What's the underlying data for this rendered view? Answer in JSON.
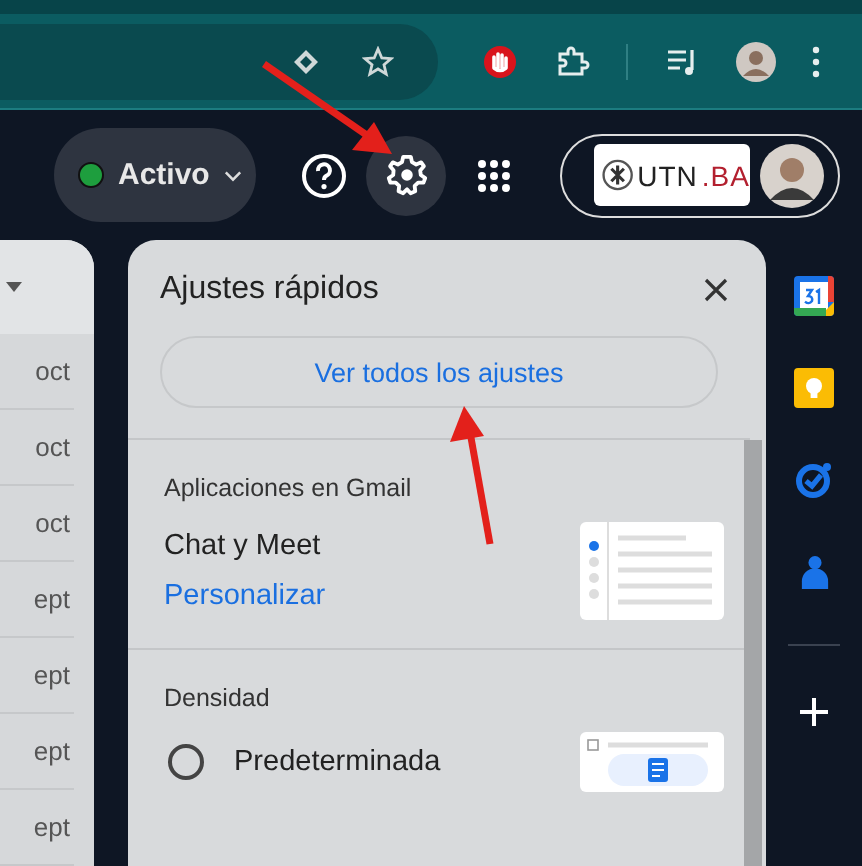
{
  "status_chip": {
    "label": "Activo",
    "online": true
  },
  "org_logo": {
    "parts": [
      "UTN",
      ".BA"
    ]
  },
  "mail_list": {
    "dates": [
      "oct",
      "oct",
      "oct",
      "ept",
      "ept",
      "ept",
      "ept"
    ]
  },
  "quick_settings": {
    "title": "Ajustes rápidos",
    "all_settings_button": "Ver todos los ajustes",
    "sections": [
      {
        "heading": "Aplicaciones en Gmail",
        "kind": "apps",
        "label": "Chat y Meet",
        "link": "Personalizar"
      },
      {
        "heading": "Densidad",
        "kind": "density",
        "label": "Predeterminada",
        "selected": false
      }
    ]
  }
}
